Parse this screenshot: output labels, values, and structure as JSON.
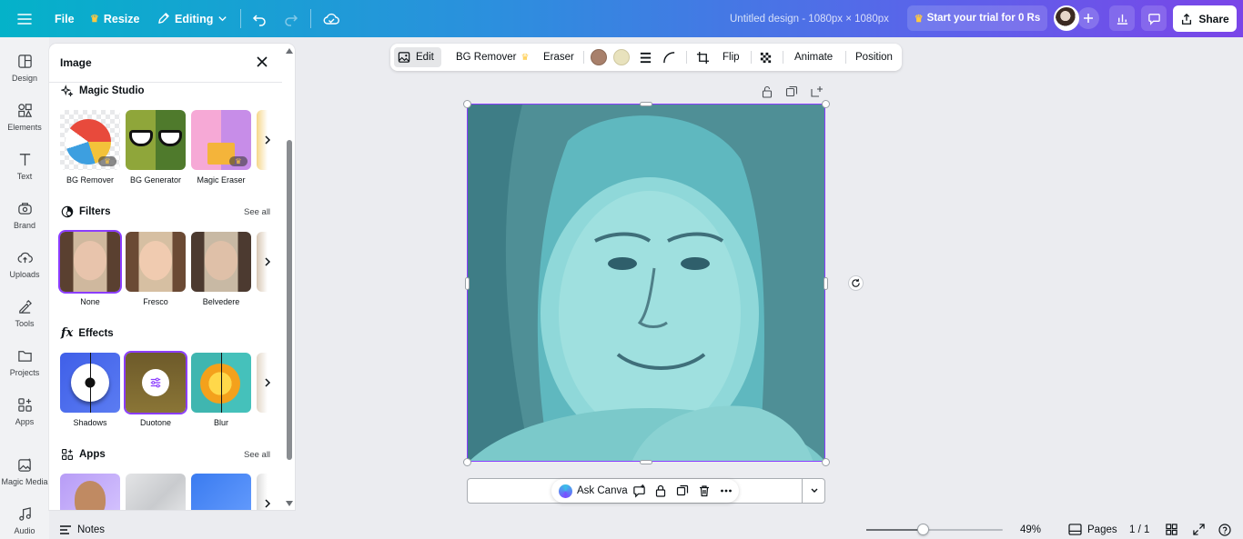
{
  "topbar": {
    "file_label": "File",
    "resize_label": "Resize",
    "editing_label": "Editing",
    "doc_title": "Untitled design - 1080px × 1080px",
    "trial_label": "Start your trial for 0 Rs",
    "share_label": "Share"
  },
  "rail": {
    "items": [
      {
        "label": "Design",
        "icon": "design-icon"
      },
      {
        "label": "Elements",
        "icon": "elements-icon"
      },
      {
        "label": "Text",
        "icon": "text-icon"
      },
      {
        "label": "Brand",
        "icon": "brand-icon"
      },
      {
        "label": "Uploads",
        "icon": "uploads-icon"
      },
      {
        "label": "Tools",
        "icon": "tools-icon"
      },
      {
        "label": "Projects",
        "icon": "projects-icon"
      },
      {
        "label": "Apps",
        "icon": "apps-icon"
      },
      {
        "label": "Magic Media",
        "icon": "magic-media-icon"
      },
      {
        "label": "Audio",
        "icon": "audio-icon"
      }
    ]
  },
  "panel": {
    "title": "Image",
    "magic_studio": {
      "heading": "Magic Studio",
      "items": [
        {
          "label": "BG Remover"
        },
        {
          "label": "BG Generator"
        },
        {
          "label": "Magic Eraser"
        }
      ]
    },
    "filters": {
      "heading": "Filters",
      "see_all": "See all",
      "items": [
        {
          "label": "None"
        },
        {
          "label": "Fresco"
        },
        {
          "label": "Belvedere"
        }
      ]
    },
    "effects": {
      "heading": "Effects",
      "items": [
        {
          "label": "Shadows"
        },
        {
          "label": "Duotone"
        },
        {
          "label": "Blur"
        }
      ]
    },
    "apps": {
      "heading": "Apps",
      "see_all": "See all"
    }
  },
  "context_toolbar": {
    "edit_label": "Edit",
    "bg_remover_label": "BG Remover",
    "eraser_label": "Eraser",
    "flip_label": "Flip",
    "animate_label": "Animate",
    "position_label": "Position",
    "duotone_colors": [
      "#a8806b",
      "#e8e2bd"
    ]
  },
  "floating_bar": {
    "ask_canva_label": "Ask Canva"
  },
  "bottombar": {
    "notes_label": "Notes",
    "zoom_value": "49%",
    "zoom_level": 0.41,
    "pages_label": "Pages",
    "page_indicator": "1 / 1"
  },
  "colors": {
    "accent": "#8b3dff",
    "photo_tint": "#7ed3d6"
  }
}
